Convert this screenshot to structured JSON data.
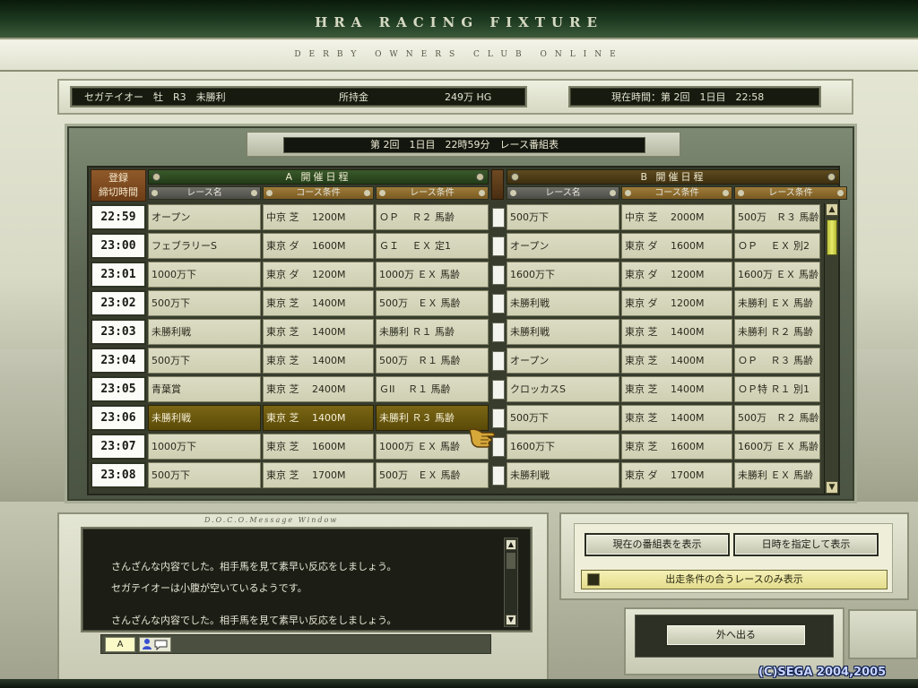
{
  "header": {
    "title": "HRA RACING FIXTURE",
    "subtitle": "DERBY OWNERS CLUB ONLINE"
  },
  "status": {
    "horse": "セガテイオー　牡　R3　未勝利",
    "money_label": "所持金",
    "money_value": "249万 HG",
    "current_time": "現在時間：第 2回　1日目　22:58"
  },
  "fixture_title": "第 2回　1日目　22時59分　レース番組表",
  "table": {
    "deadline_label_1": "登録",
    "deadline_label_2": "締切時間",
    "schedule_a": "A 開催日程",
    "schedule_b": "B 開催日程",
    "col_race": "レース名",
    "col_course": "コース条件",
    "col_cond": "レース条件",
    "selected_index": 7,
    "rows": [
      {
        "time": "22:59",
        "a_race": "オープン",
        "a_course": "中京 芝　 1200M",
        "a_cond": "ＯＰ　 Ｒ２ 馬齢",
        "b_race": "500万下",
        "b_course": "中京 芝　 2000M",
        "b_cond": "500万　Ｒ３ 馬齢"
      },
      {
        "time": "23:00",
        "a_race": "フェブラリーS",
        "a_course": "東京 ダ　 1600M",
        "a_cond": "ＧＩ　 ＥＸ 定1",
        "b_race": "オープン",
        "b_course": "東京 ダ　 1600M",
        "b_cond": "ＯＰ　 ＥＸ 別2"
      },
      {
        "time": "23:01",
        "a_race": "1000万下",
        "a_course": "東京 ダ　 1200M",
        "a_cond": "1000万 ＥＸ 馬齢",
        "b_race": "1600万下",
        "b_course": "東京 ダ　 1200M",
        "b_cond": "1600万 ＥＸ 馬齢"
      },
      {
        "time": "23:02",
        "a_race": "500万下",
        "a_course": "東京 芝　 1400M",
        "a_cond": "500万　ＥＸ 馬齢",
        "b_race": "未勝利戦",
        "b_course": "東京 ダ　 1200M",
        "b_cond": "未勝利 ＥＸ 馬齢"
      },
      {
        "time": "23:03",
        "a_race": "未勝利戦",
        "a_course": "東京 芝　 1400M",
        "a_cond": "未勝利 Ｒ１ 馬齢",
        "b_race": "未勝利戦",
        "b_course": "東京 芝　 1400M",
        "b_cond": "未勝利 Ｒ２ 馬齢"
      },
      {
        "time": "23:04",
        "a_race": "500万下",
        "a_course": "東京 芝　 1400M",
        "a_cond": "500万　Ｒ１ 馬齢",
        "b_race": "オープン",
        "b_course": "東京 芝　 1400M",
        "b_cond": "ＯＰ　 Ｒ３ 馬齢"
      },
      {
        "time": "23:05",
        "a_race": "青葉賞",
        "a_course": "東京 芝　 2400M",
        "a_cond": "ＧII　 Ｒ１ 馬齢",
        "b_race": "クロッカスS",
        "b_course": "東京 芝　 1400M",
        "b_cond": "ＯＰ特 Ｒ１ 別1"
      },
      {
        "time": "23:06",
        "a_race": "未勝利戦",
        "a_course": "東京 芝　 1400M",
        "a_cond": "未勝利 Ｒ３ 馬齢",
        "b_race": "500万下",
        "b_course": "東京 芝　 1400M",
        "b_cond": "500万　Ｒ２ 馬齢"
      },
      {
        "time": "23:07",
        "a_race": "1000万下",
        "a_course": "東京 芝　 1600M",
        "a_cond": "1000万 ＥＸ 馬齢",
        "b_race": "1600万下",
        "b_course": "東京 芝　 1600M",
        "b_cond": "1600万 ＥＸ 馬齢"
      },
      {
        "time": "23:08",
        "a_race": "500万下",
        "a_course": "東京 芝　 1700M",
        "a_cond": "500万　ＥＸ 馬齢",
        "b_race": "未勝利戦",
        "b_course": "東京 ダ　 1700M",
        "b_cond": "未勝利 ＥＸ 馬齢"
      }
    ]
  },
  "message_window": {
    "label": "D.O.C.O.Message Window",
    "lines": [
      "さんざんな内容でした。相手馬を見て素早い反応をしましょう。",
      "セガテイオーは小腹が空いているようです。",
      "",
      "さんざんな内容でした。相手馬を見て素早い反応をしましょう。"
    ],
    "ime_mode": "A"
  },
  "controls": {
    "show_current": "現在の番組表を表示",
    "show_by_date": "日時を指定して表示",
    "filter_toggle": "出走条件の合うレースのみ表示",
    "exit": "外へ出る"
  },
  "copyright": "(C)SEGA 2004,2005",
  "colors": {
    "selected_row": "#6a5810",
    "schedule_a": "#2f4a22",
    "schedule_b": "#4e3c16",
    "scroll_thumb": "#d7dc52"
  },
  "icons": {
    "cursor": "pointing-hand-icon",
    "emote": "person-chat-icon"
  }
}
